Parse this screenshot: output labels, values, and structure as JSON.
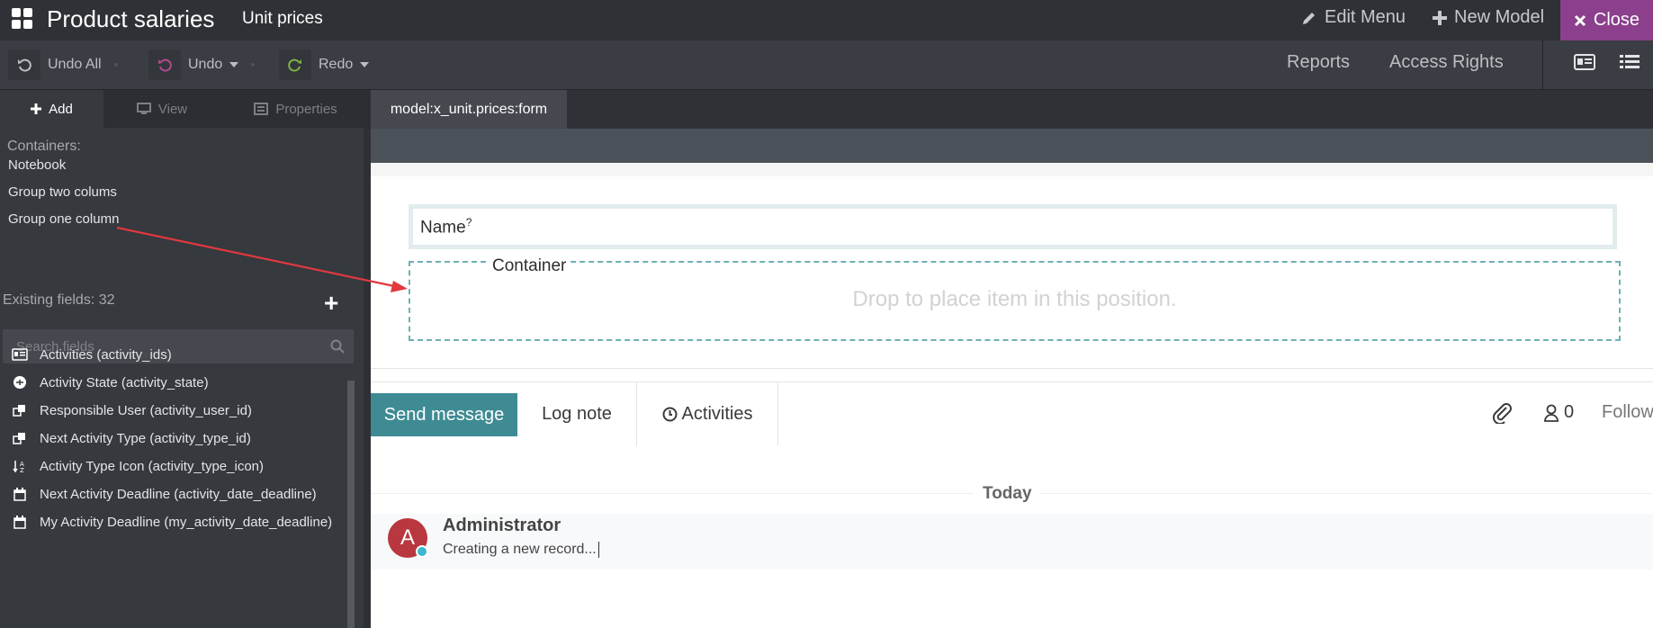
{
  "topbar": {
    "app_title": "Product salaries",
    "model_title": "Unit prices",
    "edit_menu": "Edit Menu",
    "new_model": "New Model",
    "close": "Close"
  },
  "toolbar": {
    "undo_all": "Undo All",
    "undo": "Undo",
    "redo": "Redo",
    "reports": "Reports",
    "access_rights": "Access Rights"
  },
  "sidebar": {
    "tabs": [
      {
        "label": "Add",
        "icon": "plus-icon"
      },
      {
        "label": "View",
        "icon": "monitor-icon"
      },
      {
        "label": "Properties",
        "icon": "properties-icon"
      }
    ],
    "containers_label": "Containers:",
    "containers": [
      "Notebook",
      "Group two colums",
      "Group one column"
    ],
    "existing_fields": "Existing fields: 32",
    "search_placeholder": "Search fields",
    "fields": [
      {
        "label": "Activities (activity_ids)",
        "icon": "id-card-icon"
      },
      {
        "label": "Activity State (activity_state)",
        "icon": "selection-icon"
      },
      {
        "label": "Responsible User (activity_user_id)",
        "icon": "many2one-icon"
      },
      {
        "label": "Next Activity Type (activity_type_id)",
        "icon": "many2one-icon"
      },
      {
        "label": "Activity Type Icon (activity_type_icon)",
        "icon": "char-icon"
      },
      {
        "label": "Next Activity Deadline (activity_date_deadline)",
        "icon": "calendar-icon"
      },
      {
        "label": "My Activity Deadline (my_activity_date_deadline)",
        "icon": "calendar-icon"
      }
    ]
  },
  "main": {
    "tab": "model:x_unit.prices:form",
    "name_label": "Name",
    "name_help": "?",
    "container_label": "Container",
    "drop_hint": "Drop to place item in this position."
  },
  "chatter": {
    "send_message": "Send message",
    "log_note": "Log note",
    "activities": "Activities",
    "followers_count": "0",
    "follow": "Follow",
    "today": "Today",
    "message": {
      "avatar_letter": "A",
      "author": "Administrator",
      "body": "Creating a new record..."
    }
  },
  "colors": {
    "navbar": "#2f3136",
    "close_button": "#8b3f8c",
    "send_message": "#3e8b93",
    "arrow": "#e0383e",
    "avatar": "#b9373f"
  }
}
